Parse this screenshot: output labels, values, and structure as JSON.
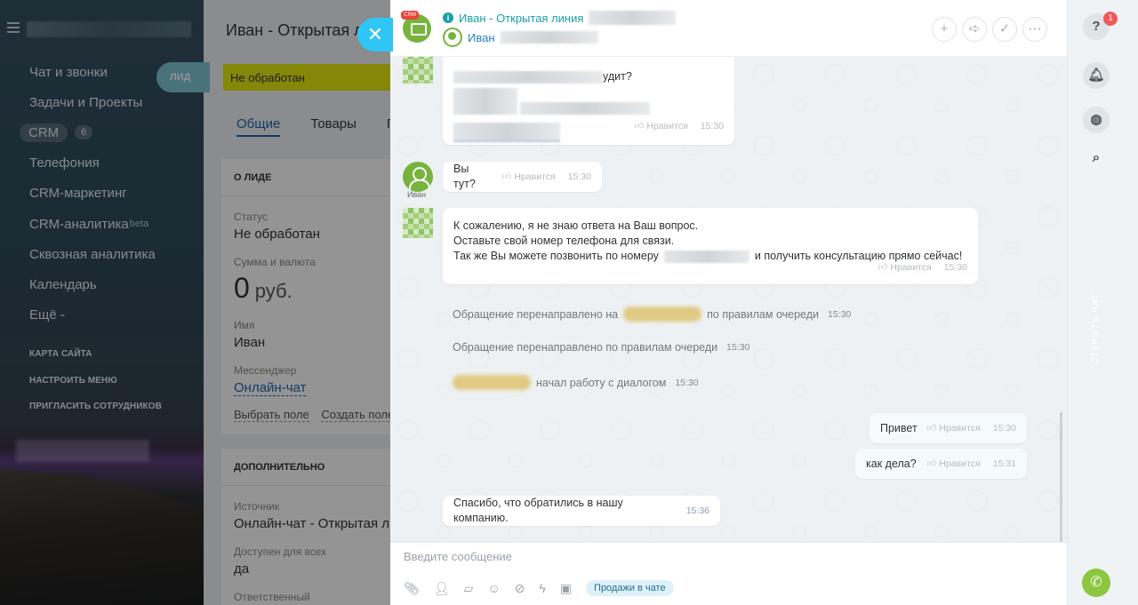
{
  "sidebar": {
    "menu": [
      {
        "label": "Чат и звонки"
      },
      {
        "label": "Задачи и Проекты"
      },
      {
        "label": "CRM",
        "count": "6"
      },
      {
        "label": "Телефония"
      },
      {
        "label": "CRM-маркетинг"
      },
      {
        "label": "CRM-аналитика",
        "sup": "beta"
      },
      {
        "label": "Сквозная аналитика"
      },
      {
        "label": "Календарь"
      },
      {
        "label": "Ещё -"
      }
    ],
    "links": [
      "КАРТА САЙТА",
      "НАСТРОИТЬ МЕНЮ",
      "ПРИГЛАСИТЬ СОТРУДНИКОВ"
    ]
  },
  "lead": {
    "title": "Иван - Открытая ли",
    "tag": "ЛИД",
    "status": "Не обработан",
    "tabs": [
      "Общие",
      "Товары",
      "П"
    ],
    "about": {
      "section": "О ЛИДЕ",
      "status_label": "Статус",
      "status_value": "Не обработан",
      "sum_label": "Сумма и валюта",
      "sum_value": "0",
      "currency": "руб.",
      "name_label": "Имя",
      "name_value": "Иван",
      "messenger_label": "Мессенджер",
      "messenger_value": "Онлайн-чат",
      "choose_field": "Выбрать поле",
      "create_field": "Создать поле"
    },
    "extra": {
      "section": "ДОПОЛНИТЕЛЬНО",
      "source_label": "Источник",
      "source_value": "Онлайн-чат - Открытая ли",
      "available_label": "Доступен для всех",
      "available_value": "да",
      "responsible_label": "Ответственный"
    }
  },
  "chat": {
    "header": {
      "crm_chip": "CRM",
      "title": "Иван - Открытая линия",
      "user": "Иван"
    },
    "messages": {
      "first_tail": "удит?",
      "first_time": "15:30",
      "like": "Нравится",
      "q": {
        "author": "Иван",
        "text": "Вы тут?",
        "time": "15:30"
      },
      "bot": {
        "line1": "К сожалению, я не знаю ответа на Ваш вопрос.",
        "line2": "Оставьте свой номер телефона для связи.",
        "line3a": "Так же Вы можете позвонить по номеру",
        "line3b": "и получить консультацию прямо сейчас!",
        "time": "15:30"
      },
      "sys1": {
        "a": "Обращение перенаправлено на",
        "b": "по правилам очереди",
        "time": "15:30"
      },
      "sys2": {
        "text": "Обращение перенаправлено по правилам очереди",
        "time": "15:30"
      },
      "sys3": {
        "text": "начал работу с диалогом",
        "time": "15:30"
      },
      "mine1": {
        "text": "Привет",
        "time": "15:30"
      },
      "mine2": {
        "text": "как дела?",
        "time": "15:31"
      },
      "thanks": {
        "text": "Спасибо, что обратились в нашу компанию.",
        "time": "15:36"
      }
    },
    "composer": {
      "placeholder": "Введите сообщение",
      "tag": "Продажи в чате"
    }
  },
  "rail": {
    "badge": "1",
    "vertical": "ОТКРЫТЬ ЧАТ"
  }
}
